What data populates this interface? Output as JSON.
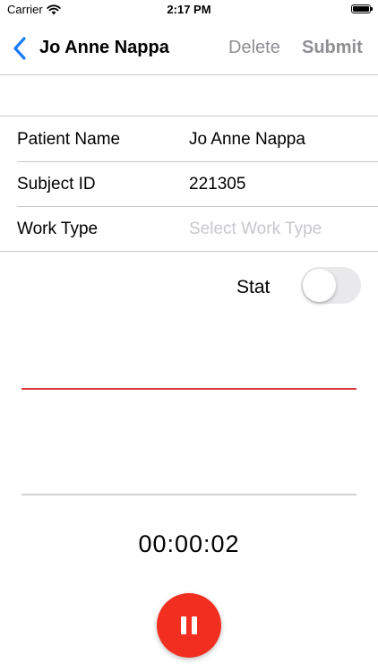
{
  "status_bar": {
    "carrier": "Carrier",
    "time": "2:17 PM"
  },
  "nav": {
    "title": "Jo Anne Nappa",
    "delete_label": "Delete",
    "submit_label": "Submit"
  },
  "form": {
    "rows": [
      {
        "label": "Patient Name",
        "value": "Jo Anne Nappa"
      },
      {
        "label": "Subject ID",
        "value": "221305"
      },
      {
        "label": "Work Type",
        "placeholder": "Select Work Type"
      }
    ]
  },
  "stat": {
    "label": "Stat",
    "enabled": false
  },
  "recorder": {
    "elapsed": "00:00:02",
    "waveform_color": "#d9393b",
    "button_color": "#f12e1f",
    "button_icon": "pause-icon"
  },
  "colors": {
    "accent": "#1a7cf5",
    "disabled": "#8e8e93",
    "placeholder": "#c7c7cd"
  }
}
